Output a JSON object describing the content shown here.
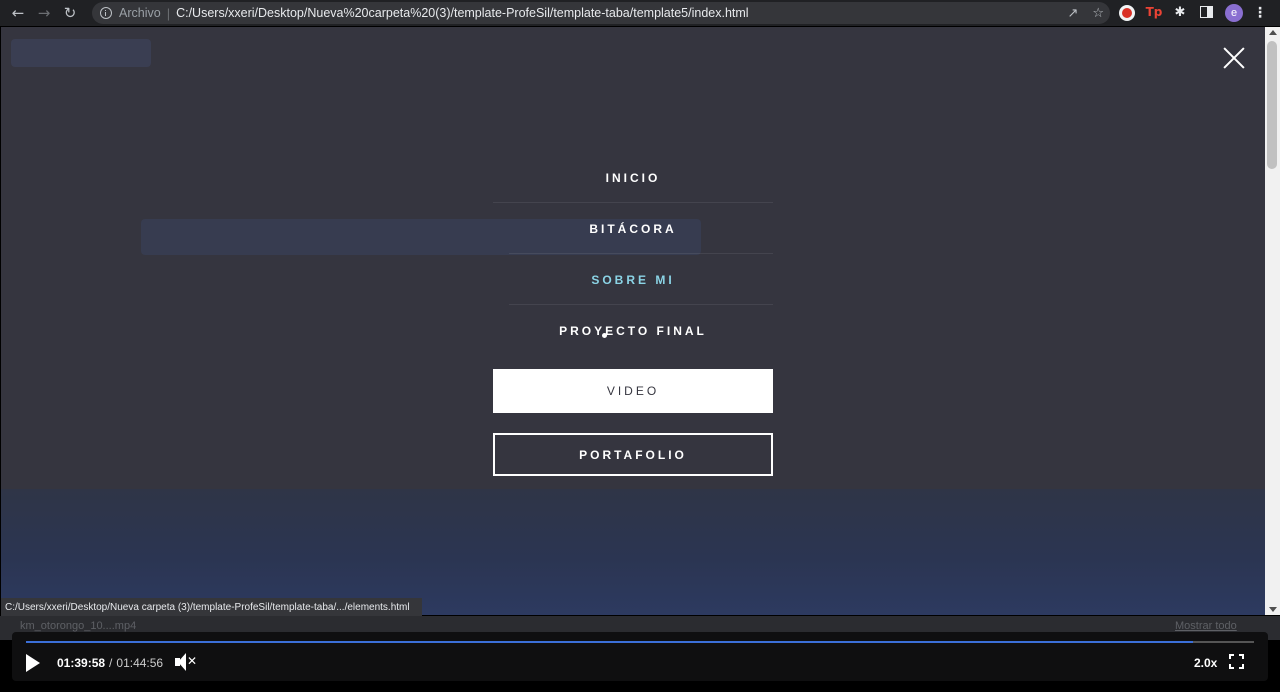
{
  "browser": {
    "scheme_label": "Archivo",
    "separator": "|",
    "url": "C:/Users/xxeri/Desktop/Nueva%20carpeta%20(3)/template-ProfeSil/template-taba/template5/index.html",
    "profile_initial": "e",
    "extension_tp_label": "Tp"
  },
  "menu": {
    "items": [
      {
        "label": "INICIO",
        "active": false
      },
      {
        "label": "BITÁCORA",
        "active": false
      },
      {
        "label": "SOBRE MI",
        "active": true
      },
      {
        "label": "PROYECTO FINAL",
        "active": false
      }
    ],
    "video_button": "VIDEO",
    "portfolio_button": "PORTAFOLIO",
    "accent_color": "#8bd4e6"
  },
  "status_link": "C:/Users/xxeri/Desktop/Nueva carpeta (3)/template-ProfeSil/template-taba/.../elements.html",
  "download_shelf": {
    "item": "km_otorongo_10....mp4",
    "show_all": "Mostrar todo"
  },
  "player": {
    "current_time": "01:39:58",
    "time_separator": "/",
    "duration": "01:44:56",
    "speed": "2.0x",
    "progress_fraction": 0.95,
    "progress_color": "#3b6fd8"
  }
}
